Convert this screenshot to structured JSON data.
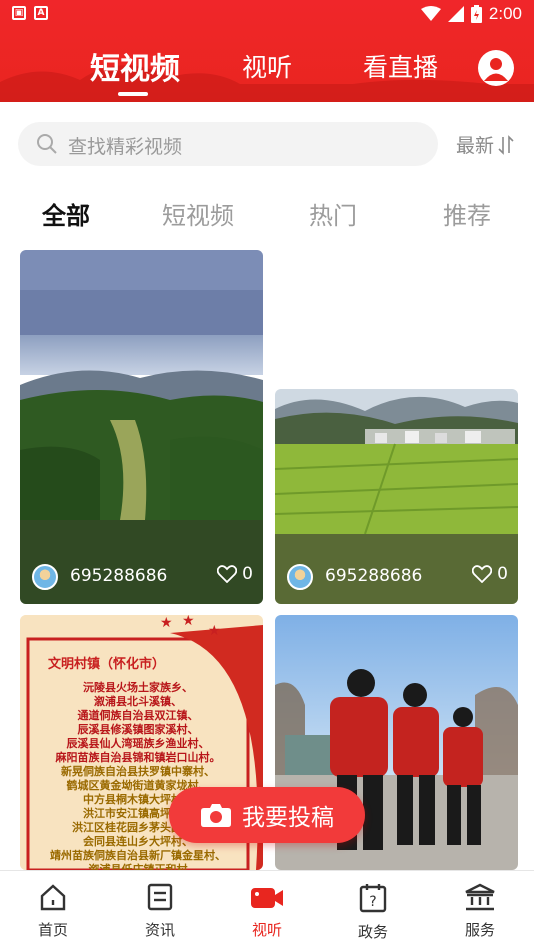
{
  "status_bar": {
    "time": "2:00"
  },
  "top_nav": {
    "tabs": [
      {
        "label": "短视频",
        "active": true
      },
      {
        "label": "视听",
        "active": false
      },
      {
        "label": "看直播",
        "active": false
      }
    ]
  },
  "search": {
    "placeholder": "查找精彩视频",
    "sort_label": "最新"
  },
  "categories": [
    {
      "label": "全部",
      "active": true
    },
    {
      "label": "短视频",
      "active": false
    },
    {
      "label": "热门",
      "active": false
    },
    {
      "label": "推荐",
      "active": false
    }
  ],
  "videos": [
    {
      "username": "695288686",
      "likes": "0"
    },
    {
      "username": "695288686",
      "likes": "0"
    },
    {
      "poster_title": "文明村镇（怀化市）",
      "poster_lines": [
        "沅陵县火场土家族乡、",
        "溆浦县北斗溪镇、",
        "通道侗族自治县双江镇、",
        "辰溪县修溪镇图家溪村、",
        "辰溪县仙人湾瑶族乡渔业村、",
        "麻阳苗族自治县锦和镇岩口山村。",
        "新晃侗族自治县扶罗镇中寨村、",
        "鹤城区黄金坳街道黄家垅村、",
        "中方县桐木镇大坪村、",
        "洪江市安江镇高坪村、",
        "洪江区桂花园乡茅头园村、",
        "会同县连山乡大坪村、",
        "靖州苗族侗族自治县新厂镇金星村、",
        "溆浦县低庄镇正和村"
      ]
    },
    {}
  ],
  "post_button": {
    "label": "我要投稿"
  },
  "bottom_nav": [
    {
      "label": "首页",
      "icon": "home-icon",
      "active": false
    },
    {
      "label": "资讯",
      "icon": "news-icon",
      "active": false
    },
    {
      "label": "视听",
      "icon": "video-camera-icon",
      "active": true
    },
    {
      "label": "政务",
      "icon": "government-affairs-icon",
      "active": false
    },
    {
      "label": "服务",
      "icon": "service-building-icon",
      "active": false
    }
  ],
  "colors": {
    "brand_red": "#e9251f",
    "inactive_text": "#9c9c9c",
    "active_tab_text": "#111111"
  }
}
